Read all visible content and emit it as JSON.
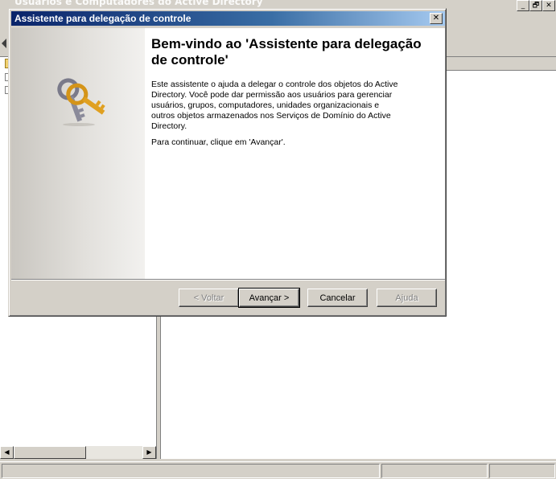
{
  "background_window": {
    "title": "Usuários e Computadores do Active Directory",
    "buttons": [
      "_",
      "🗗",
      "✕"
    ]
  },
  "dialog": {
    "title": "Assistente para delegação de controle",
    "close_glyph": "✕",
    "icon": "keys-icon",
    "heading": "Bem-vindo ao 'Assistente para delegação de controle'",
    "description": "Este assistente o ajuda a delegar o controle dos objetos do Active Directory. Você pode dar permissão aos usuários para gerenciar usuários, grupos, computadores, unidades organizacionais e outros objetos armazenados nos Serviços de Domínio do Active Directory.",
    "continue_hint": "Para continuar, clique em 'Avançar'.",
    "buttons": {
      "back": "< Voltar",
      "next": "Avançar >",
      "cancel": "Cancelar",
      "help": "Ajuda"
    }
  },
  "colors": {
    "titlebar": "#0a246a",
    "face": "#d4d0c8",
    "key_gold": "#e0a020",
    "key_silver": "#8a8a9a"
  }
}
